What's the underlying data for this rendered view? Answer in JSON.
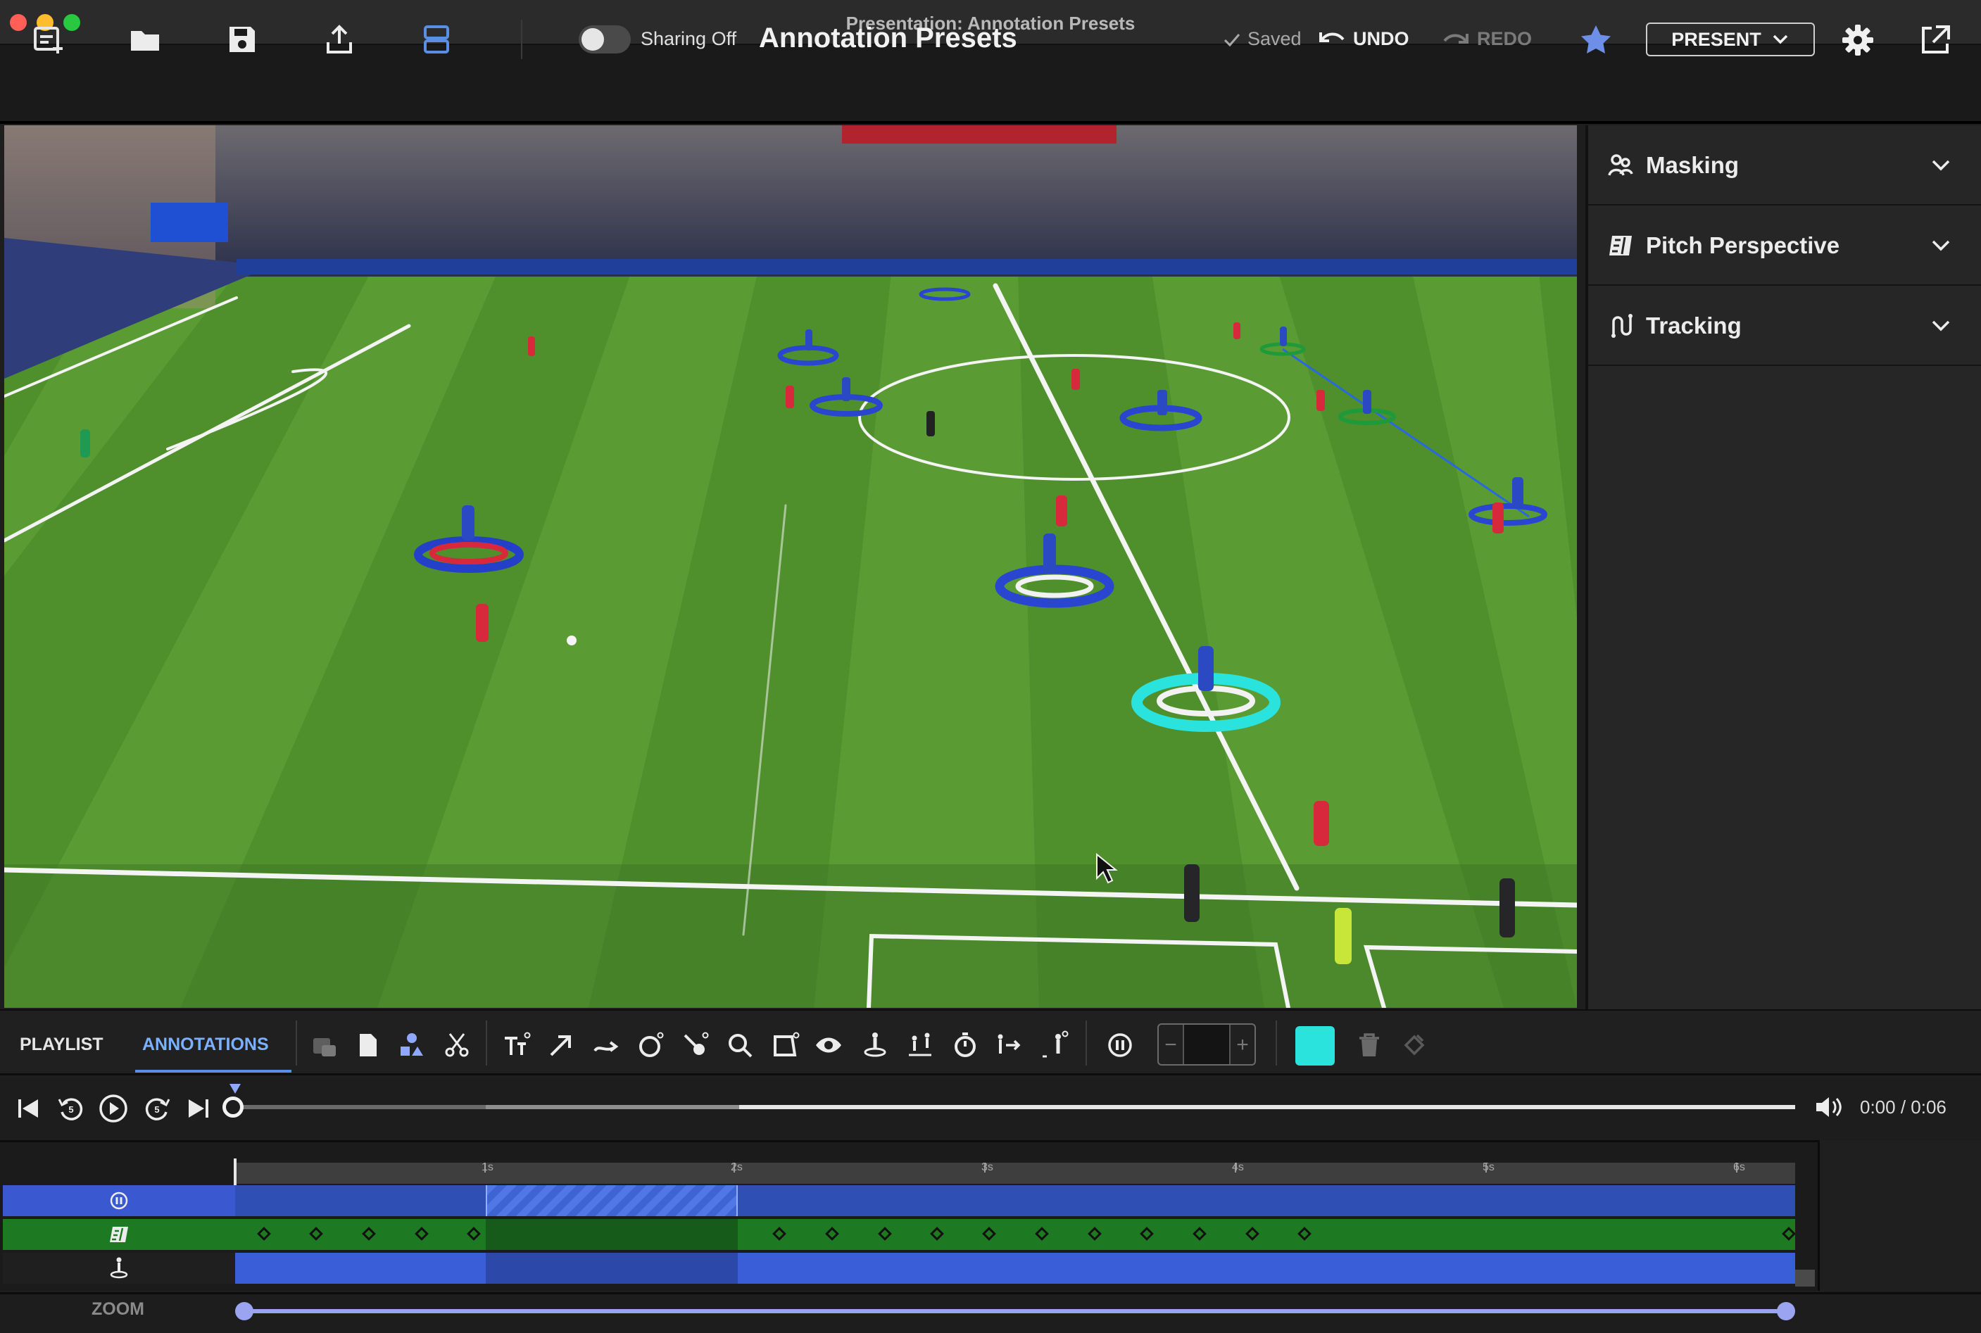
{
  "window": {
    "title": "Presentation: Annotation Presets"
  },
  "toolbar": {
    "icons": [
      "add-slide-icon",
      "folder-icon",
      "save-icon",
      "export-icon",
      "layout-icon"
    ],
    "sharing_label": "Sharing Off",
    "sharing_on": false,
    "presentation_title": "Annotation Presets",
    "saved_label": "Saved",
    "undo_label": "UNDO",
    "redo_label": "REDO",
    "present_label": "PRESENT"
  },
  "side_panel": {
    "sections": [
      {
        "label": "Masking",
        "icon": "masking-icon"
      },
      {
        "label": "Pitch Perspective",
        "icon": "pitch-perspective-icon"
      },
      {
        "label": "Tracking",
        "icon": "tracking-icon"
      }
    ]
  },
  "annotation_bar": {
    "tabs": [
      {
        "label": "PLAYLIST",
        "active": false
      },
      {
        "label": "ANNOTATIONS",
        "active": true
      }
    ],
    "tools": [
      "clip-icon",
      "page-icon",
      "shapes-icon",
      "scissors-icon",
      "text-tool-icon",
      "arrow-tool-icon",
      "curved-arrow-icon",
      "circle-tool-icon",
      "spotlight-icon",
      "magnifier-icon",
      "polygon-tool-icon",
      "eye-icon",
      "player-marker-icon",
      "player-link-icon",
      "timer-icon",
      "movement-icon",
      "player-highlight-icon",
      "pause-annotation-icon"
    ],
    "selected_color": "#2BE3DD"
  },
  "transport": {
    "time_display": "0:00 / 0:06",
    "progress": 0.0
  },
  "timeline": {
    "ticks": [
      "1s",
      "2s",
      "3s",
      "4s",
      "5s",
      "6s"
    ],
    "tracks": [
      "pause-track",
      "pitch-perspective-track",
      "player-marker-track"
    ],
    "zoom_label": "ZOOM"
  },
  "colors": {
    "accent_blue": "#5B8FE6",
    "annotation_cyan": "#2BE3DD",
    "track_blue": "#2F4FB5",
    "track_green": "#1E7A22"
  }
}
